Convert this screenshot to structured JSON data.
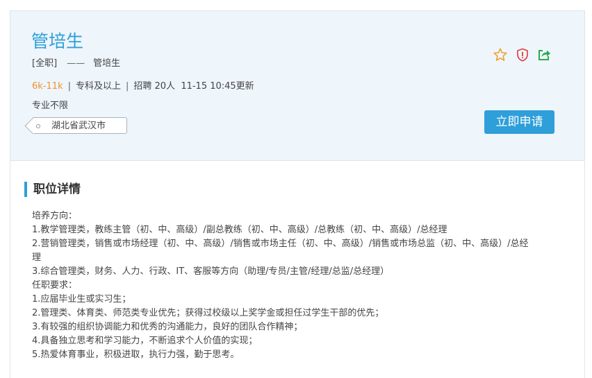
{
  "header": {
    "title": "管培生",
    "job_type": "[全职]",
    "separator": "——",
    "subtitle": "管培生",
    "salary": "6k-11k",
    "meta_sep": "|",
    "education": "专科及以上",
    "recruit": "招聘 20人",
    "updated": "11-15 10:45更新",
    "major": "专业不限",
    "location": "湖北省武汉市",
    "apply_label": "立即申请",
    "icons": {
      "favorite": "star-icon",
      "report": "shield-alert-icon",
      "share": "share-icon"
    }
  },
  "details": {
    "heading": "职位详情",
    "lines": [
      "培养方向：",
      "1.教学管理类，教练主管（初、中、高级）/副总教练（初、中、高级）/总教练（初、中、高级）/总经理",
      "2.营销管理类，销售或市场经理（初、中、高级）/销售或市场主任（初、中、高级）/销售或市场总监（初、中、高级）/总经",
      "理",
      "3.综合管理类，财务、人力、行政、IT、客服等方向（助理/专员/主管/经理/总监/总经理）",
      "任职要求：",
      "1.应届毕业生或实习生；",
      "2.管理类、体育类、师范类专业优先；获得过校级以上奖学金或担任过学生干部的优先；",
      "3.有较强的组织协调能力和优秀的沟通能力，良好的团队合作精神；",
      "4.具备独立思考和学习能力，不断追求个人价值的实现；",
      "5.热爱体育事业，积极进取，执行力强，勤于思考。"
    ]
  },
  "colors": {
    "accent": "#2e9fd8",
    "salary": "#f0932b",
    "star": "#f0a030",
    "report": "#e03c3c",
    "share": "#2eaa4a",
    "header_bg": "#eef5fb"
  }
}
